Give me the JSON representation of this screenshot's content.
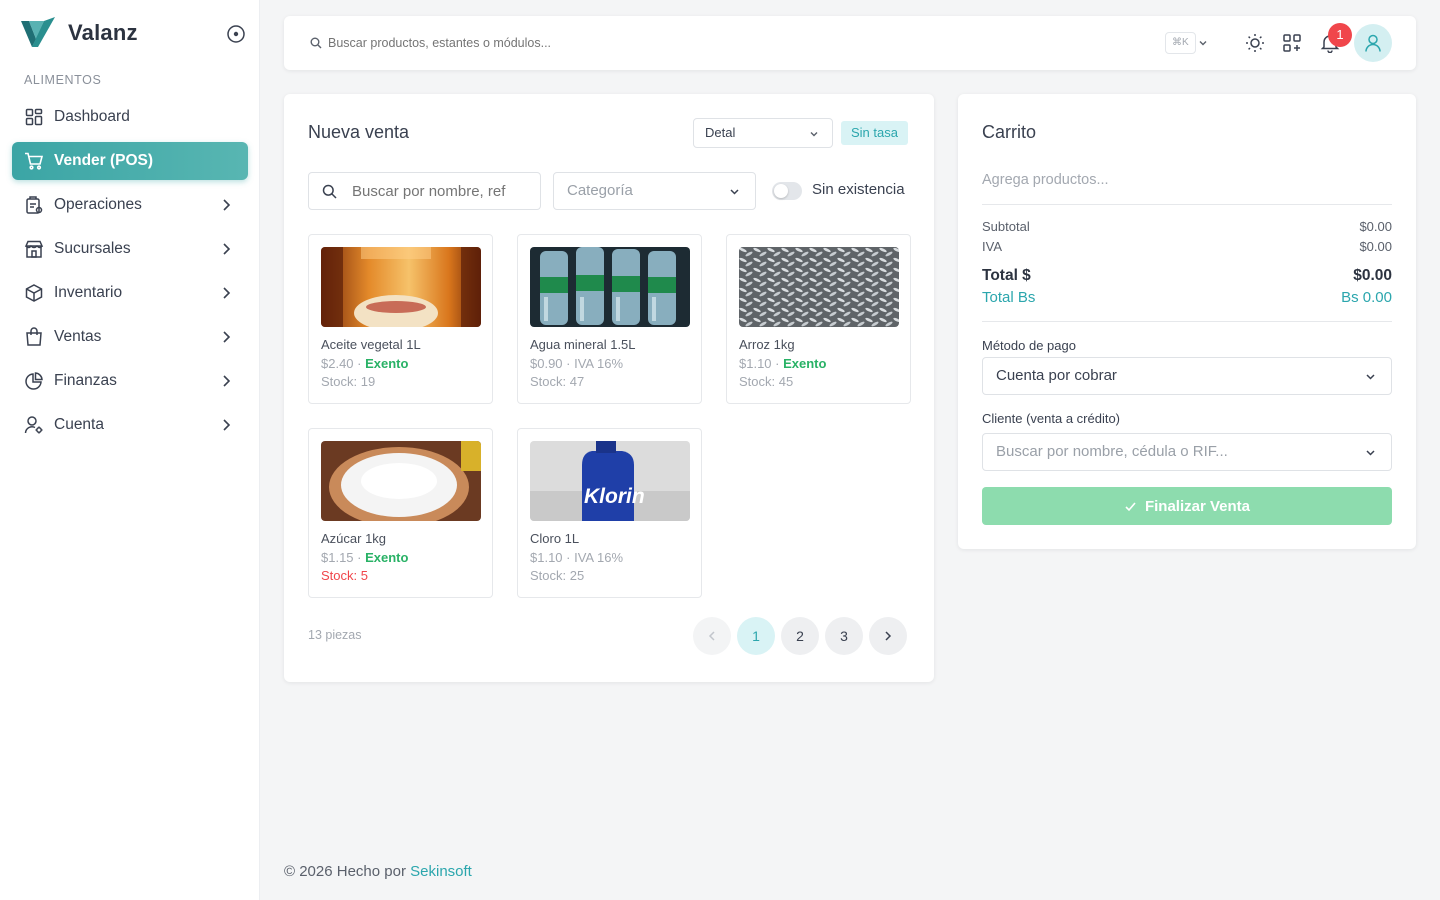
{
  "brand": {
    "name": "Valanz",
    "accent": "#3ba5a5"
  },
  "sidebar": {
    "section_label": "ALIMENTOS",
    "items": [
      {
        "label": "Dashboard",
        "icon": "dashboard-icon",
        "has_children": false,
        "active": false
      },
      {
        "label": "Vender (POS)",
        "icon": "cart-icon",
        "has_children": false,
        "active": true
      },
      {
        "label": "Operaciones",
        "icon": "operations-icon",
        "has_children": true
      },
      {
        "label": "Sucursales",
        "icon": "store-icon",
        "has_children": true
      },
      {
        "label": "Inventario",
        "icon": "box-icon",
        "has_children": true
      },
      {
        "label": "Ventas",
        "icon": "bag-icon",
        "has_children": true
      },
      {
        "label": "Finanzas",
        "icon": "pie-chart-icon",
        "has_children": true
      },
      {
        "label": "Cuenta",
        "icon": "user-gear-icon",
        "has_children": true
      }
    ]
  },
  "topbar": {
    "search_placeholder": "Buscar productos, estantes o módulos...",
    "shortcut": "⌘K",
    "notification_count": "1"
  },
  "sale": {
    "title": "Nueva venta",
    "mode": "Detal",
    "rate_badge": "Sin tasa",
    "search_placeholder": "Buscar por nombre, ref",
    "category_placeholder": "Categoría",
    "toggle_label": "Sin existencia",
    "products": [
      {
        "name": "Aceite vegetal 1L",
        "price": "$2.40",
        "tax": "Exento",
        "stock": "Stock: 19",
        "low": false,
        "image": "oil-bottle"
      },
      {
        "name": "Agua mineral 1.5L",
        "price": "$0.90",
        "tax": "IVA 16%",
        "stock": "Stock: 47",
        "low": false,
        "image": "water-bottles"
      },
      {
        "name": "Arroz 1kg",
        "price": "$1.10",
        "tax": "Exento",
        "stock": "Stock: 45",
        "low": false,
        "image": "rice-grains"
      },
      {
        "name": "Azúcar 1kg",
        "price": "$1.15",
        "tax": "Exento",
        "stock": "Stock: 5",
        "low": true,
        "image": "sugar-bowl"
      },
      {
        "name": "Cloro 1L",
        "price": "$1.10",
        "tax": "IVA 16%",
        "stock": "Stock: 25",
        "low": false,
        "image": "bleach-bottle",
        "image_text": "Klorin"
      }
    ],
    "pieces": "13 piezas",
    "pages": [
      "1",
      "2",
      "3"
    ],
    "current_page": "1"
  },
  "cart": {
    "title": "Carrito",
    "empty": "Agrega productos...",
    "subtotal_label": "Subtotal",
    "subtotal": "$0.00",
    "iva_label": "IVA",
    "iva": "$0.00",
    "total_label": "Total $",
    "total": "$0.00",
    "total_bs_label": "Total Bs",
    "total_bs": "Bs 0.00",
    "payment_label": "Método de pago",
    "payment_value": "Cuenta por cobrar",
    "client_label": "Cliente (venta a crédito)",
    "client_placeholder": "Buscar por nombre, cédula o RIF...",
    "finish_label": "Finalizar Venta"
  },
  "footer": {
    "text": "© 2026 Hecho por",
    "link": "Sekinsoft"
  }
}
